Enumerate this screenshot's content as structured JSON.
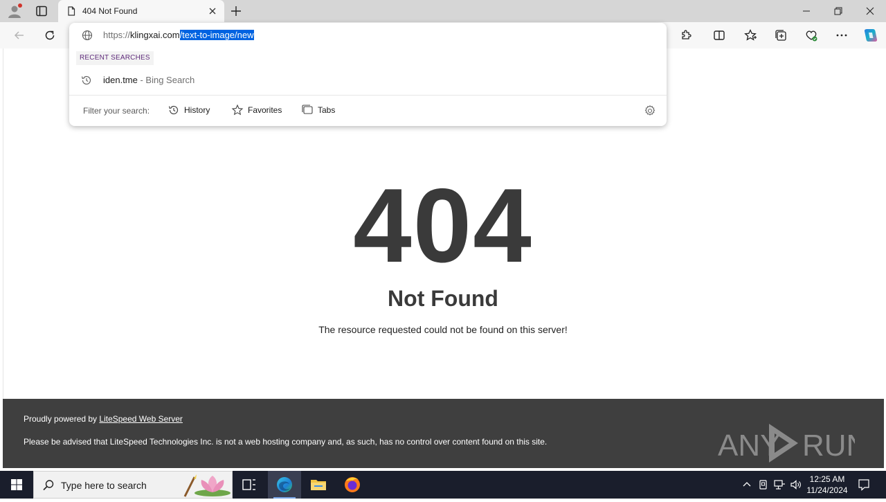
{
  "browser": {
    "tab": {
      "title": "404 Not Found"
    },
    "address": {
      "scheme": "https://",
      "host": "klingxai.com",
      "path_selected": "/text-to-image/new"
    },
    "dropdown": {
      "section_label": "RECENT SEARCHES",
      "suggestion": {
        "query": "iden.tme",
        "source": " - Bing Search"
      },
      "filter_label": "Filter your search:",
      "filters": [
        {
          "label": "History",
          "icon": "history-icon"
        },
        {
          "label": "Favorites",
          "icon": "star-icon"
        },
        {
          "label": "Tabs",
          "icon": "tabs-icon"
        }
      ]
    }
  },
  "page": {
    "code": "404",
    "title": "Not Found",
    "message": "The resource requested could not be found on this server!",
    "footer": {
      "powered_prefix": "Proudly powered by ",
      "powered_link": "LiteSpeed Web Server",
      "notice": "Please be advised that LiteSpeed Technologies Inc. is not a web hosting company and, as such, has no control over content found on this site."
    }
  },
  "watermark": {
    "left": "ANY",
    "right": "RUN"
  },
  "taskbar": {
    "search_placeholder": "Type here to search",
    "time": "12:25 AM",
    "date": "11/24/2024"
  },
  "colors": {
    "text_dark": "#3a3a3a",
    "footer_bg": "#3f3f3f",
    "selection": "#0063e1",
    "taskbar_bg": "#1a1e2c"
  }
}
